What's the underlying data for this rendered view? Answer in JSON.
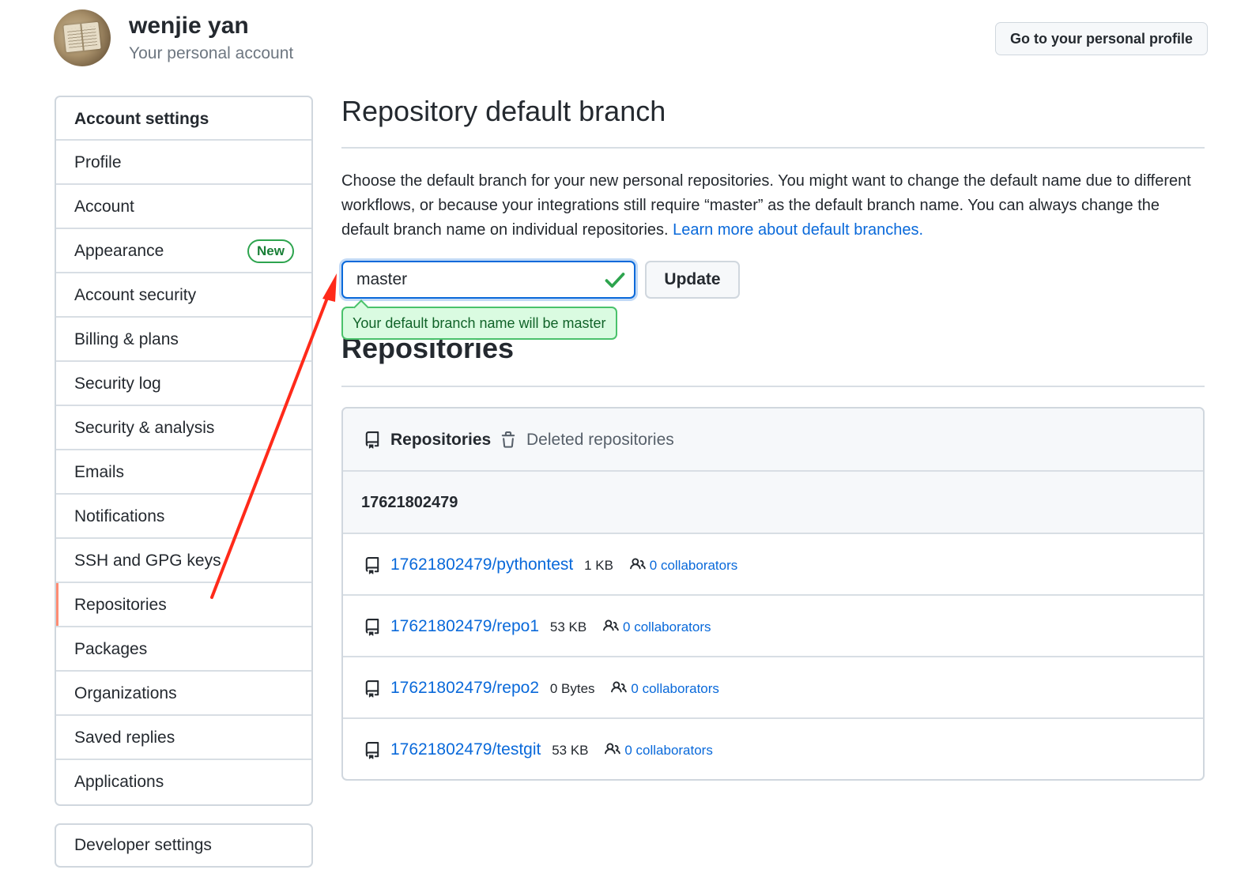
{
  "header": {
    "user_name": "wenjie yan",
    "user_subtitle": "Your personal account",
    "profile_button": "Go to your personal profile"
  },
  "sidebar": {
    "heading": "Account settings",
    "items": [
      {
        "label": "Profile"
      },
      {
        "label": "Account"
      },
      {
        "label": "Appearance",
        "badge": "New"
      },
      {
        "label": "Account security"
      },
      {
        "label": "Billing & plans"
      },
      {
        "label": "Security log"
      },
      {
        "label": "Security & analysis"
      },
      {
        "label": "Emails"
      },
      {
        "label": "Notifications"
      },
      {
        "label": "SSH and GPG keys"
      },
      {
        "label": "Repositories",
        "selected": true
      },
      {
        "label": "Packages"
      },
      {
        "label": "Organizations"
      },
      {
        "label": "Saved replies"
      },
      {
        "label": "Applications"
      }
    ],
    "developer_settings": "Developer settings"
  },
  "default_branch": {
    "title": "Repository default branch",
    "description": "Choose the default branch for your new personal repositories. You might want to change the default name due to different workflows, or because your integrations still require “master” as the default branch name. You can always change the default branch name on individual repositories.",
    "learn_more": "Learn more about default branches.",
    "input_value": "master",
    "update_button": "Update",
    "tooltip": "Your default branch name will be master"
  },
  "repositories": {
    "title": "Repositories",
    "tabs": {
      "active": "Repositories",
      "deleted": "Deleted repositories"
    },
    "owner": "17621802479",
    "items": [
      {
        "name": "17621802479/pythontest",
        "size": "1 KB",
        "collaborators": "0 collaborators"
      },
      {
        "name": "17621802479/repo1",
        "size": "53 KB",
        "collaborators": "0 collaborators"
      },
      {
        "name": "17621802479/repo2",
        "size": "0 Bytes",
        "collaborators": "0 collaborators"
      },
      {
        "name": "17621802479/testgit",
        "size": "53 KB",
        "collaborators": "0 collaborators"
      }
    ]
  },
  "colors": {
    "link": "#0969da",
    "badge_green": "#1a7f37",
    "selected_marker": "#fd8c73",
    "annotation_arrow": "#ff2a1a"
  }
}
